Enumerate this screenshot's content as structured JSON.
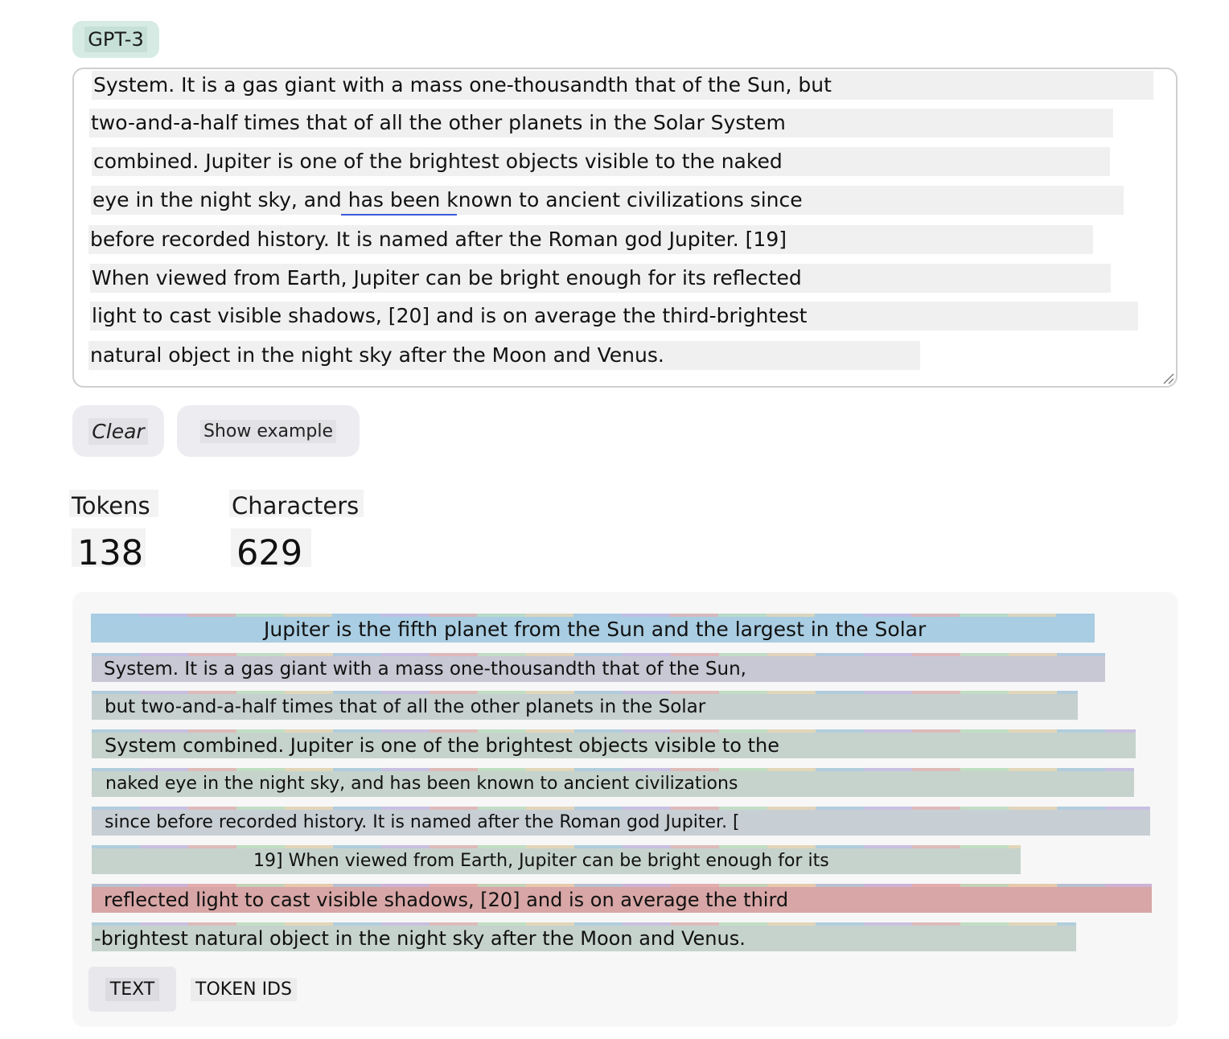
{
  "model": {
    "label": "GPT-3"
  },
  "editor": {
    "lines": [
      "System. It is a gas giant with a mass one-thousandth that of the Sun, but",
      "two-and-a-half times that of all the other planets in the Solar System",
      "combined. Jupiter is one of the brightest objects visible to the naked",
      "eye in the night sky, and has been known to ancient civilizations since",
      "before recorded history. It is named after the Roman god Jupiter. [19]",
      "When viewed from Earth, Jupiter can be bright enough for its reflected",
      "light to cast visible shadows, [20] and is on average the third-brightest",
      "natural object in the night sky after the Moon and Venus."
    ]
  },
  "buttons": {
    "clear": "Clear",
    "show_example": "Show example"
  },
  "stats": {
    "tokens_label": "Tokens",
    "tokens_value": "138",
    "characters_label": "Characters",
    "characters_value": "629"
  },
  "tokenized": {
    "lines": [
      {
        "text": "Jupiter is the fifth planet from the Sun and the largest in the Solar",
        "color": "#a9cde2"
      },
      {
        "text": "System. It is a gas giant with a mass one-thousandth that of the Sun,",
        "color": "#c8c8d4"
      },
      {
        "text": "but two-and-a-half times that of all the other planets in the Solar",
        "color": "#c6d0cf"
      },
      {
        "text": "System combined. Jupiter is one of the brightest objects visible to the",
        "color": "#c6d3cd"
      },
      {
        "text": "naked eye in the night sky, and has been known to ancient civilizations",
        "color": "#c6d3cd"
      },
      {
        "text": "since before recorded history. It is named after the Roman god Jupiter. [",
        "color": "#c8cfd4"
      },
      {
        "text": "19] When viewed from Earth, Jupiter can be bright enough for its",
        "color": "#c6d3cd"
      },
      {
        "text": "reflected light to cast visible shadows, [20] and is on average the third",
        "color": "#d8a6a6"
      },
      {
        "text": "-brightest natural object in the night sky after the Moon and Venus.",
        "color": "#c6d3cd"
      }
    ]
  },
  "tabs": {
    "text": "TEXT",
    "token_ids": "TOKEN IDS"
  }
}
